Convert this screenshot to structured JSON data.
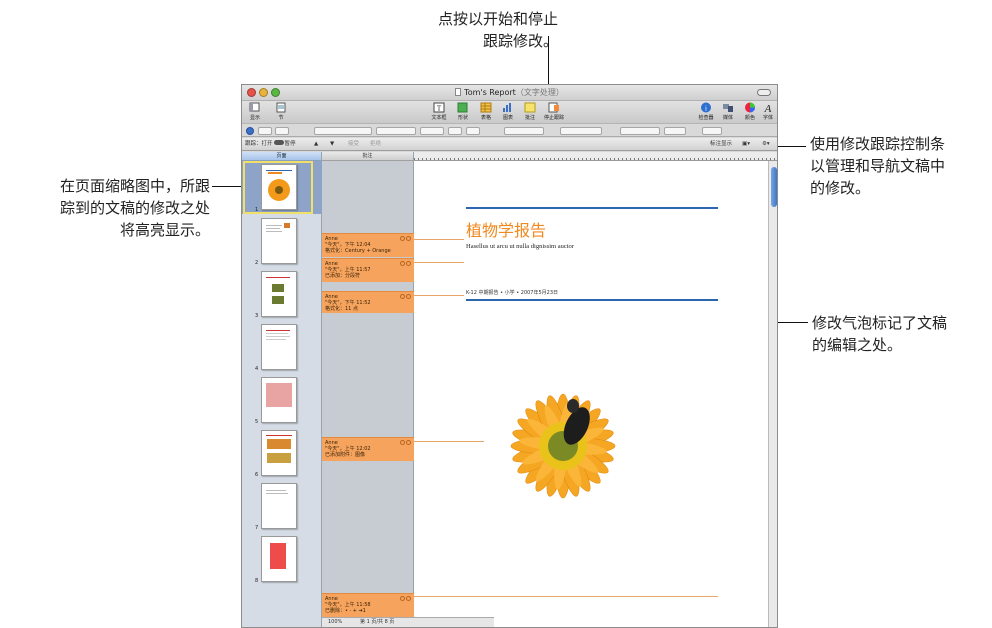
{
  "callouts": {
    "top": [
      "点按以开始和停止",
      "跟踪修改。"
    ],
    "left": [
      "在页面缩略图中，所跟",
      "踪到的文稿的修改之处",
      "将高亮显示。"
    ],
    "right_control": [
      "使用修改跟踪控制条",
      "以管理和导航文稿中",
      "的修改。"
    ],
    "right_bubble": [
      "修改气泡标记了文稿",
      "的编辑之处。"
    ]
  },
  "window": {
    "title": "Tom's Report",
    "title_suffix": "（文字处理）"
  },
  "toolbar": {
    "view": "显示",
    "sections": "节",
    "textbox": "文本框",
    "shapes": "形状",
    "table": "表格",
    "chart": "图表",
    "comment": "批注",
    "stop_tracking": "停止跟踪",
    "inspector": "检查器",
    "media": "媒体",
    "colors": "颜色",
    "fonts": "字体"
  },
  "trackbar": {
    "tracking_label": "跟踪：",
    "on": "打开",
    "pause": "暂停",
    "accept": "接受",
    "reject": "拒绝",
    "markup_label": "标注显示"
  },
  "sidebar": {
    "header": "页面",
    "pages": [
      "1",
      "2",
      "3",
      "4",
      "5",
      "6",
      "7",
      "8"
    ]
  },
  "annotations": {
    "header": "批注",
    "bubbles": [
      {
        "author": "Anne",
        "time": "\"今天\"，下午 12:04",
        "change": "格式化：Century + Orange"
      },
      {
        "author": "Anne",
        "time": "\"今天\"，上午 11:57",
        "change": "已添加：分段符"
      },
      {
        "author": "Anne",
        "time": "\"今天\"，下午 11:52",
        "change": "格式化：11 点"
      },
      {
        "author": "Anne",
        "time": "\"今天\"，上午 12:02",
        "change": "已添加附件：图像"
      },
      {
        "author": "Anne",
        "time": "\"今天\"，上午 11:58",
        "change": "已删除：• · + ➜1"
      }
    ]
  },
  "document": {
    "title": "植物学报告",
    "subtitle": "Hasellus ut arcu ut nulla dignissim auctor",
    "meta": "K-12 中期报告 • 小学 • 2007年5月23日"
  },
  "status": {
    "zoom": "100%",
    "page_info": "第 1 页/共 8 页"
  },
  "colors": {
    "accent_orange": "#f0891f",
    "bubble": "#f6a45d",
    "rule_blue": "#2a67b0",
    "thumb_highlight": "#f0e06a"
  }
}
